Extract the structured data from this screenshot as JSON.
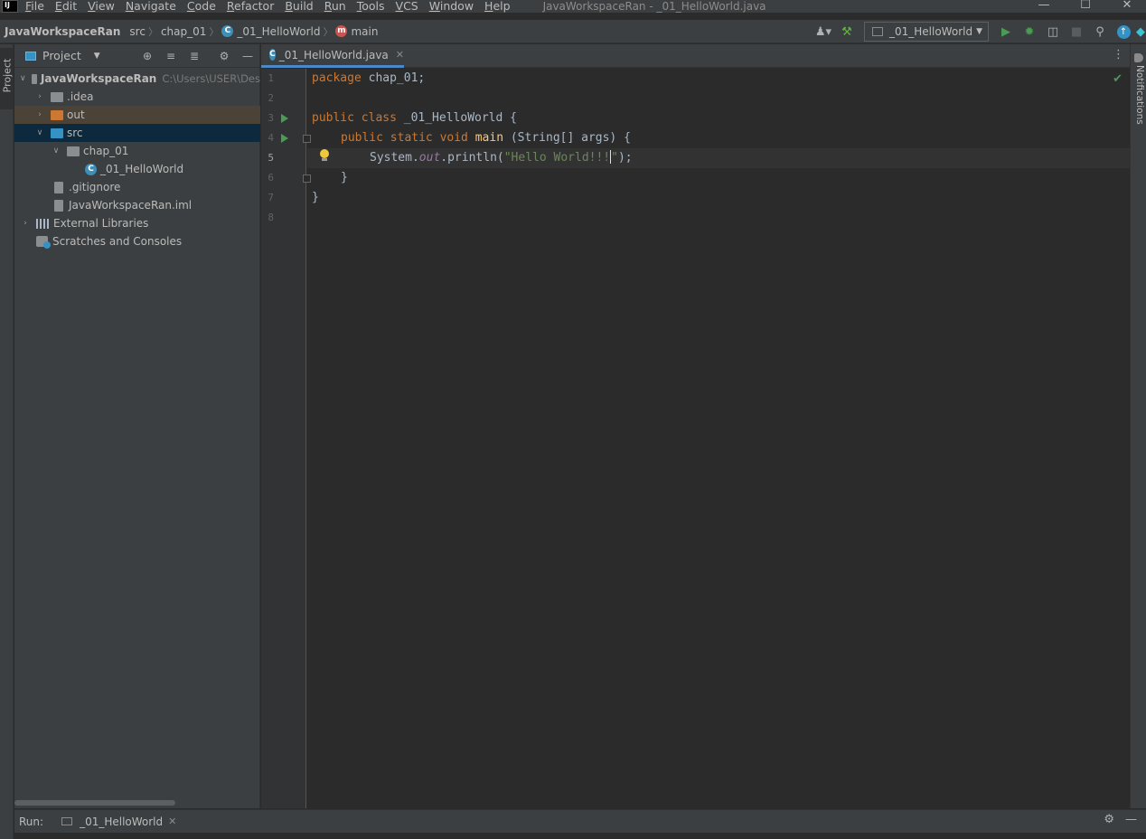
{
  "app": {
    "logo": "IJ",
    "window_title": "JavaWorkspaceRan - _01_HelloWorld.java",
    "menu": [
      "File",
      "Edit",
      "View",
      "Navigate",
      "Code",
      "Refactor",
      "Build",
      "Run",
      "Tools",
      "VCS",
      "Window",
      "Help"
    ],
    "window_controls": {
      "minimize": "—",
      "maximize": "☐",
      "close": "✕"
    }
  },
  "navbar": {
    "crumbs": [
      "JavaWorkspaceRan",
      "src",
      "chap_01",
      "_01_HelloWorld",
      "main"
    ],
    "class_icon": "C",
    "method_icon": "m",
    "run_config": "_01_HelloWorld"
  },
  "left_strip": {
    "project_tab": "Project"
  },
  "right_strip": {
    "notifications_tab": "Notifications"
  },
  "project_panel": {
    "title": "Project",
    "tree": {
      "root": {
        "label": "JavaWorkspaceRan",
        "path": "C:\\Users\\USER\\Des"
      },
      "idea": ".idea",
      "out": "out",
      "src": "src",
      "chap": "chap_01",
      "hello": "_01_HelloWorld",
      "gitignore": ".gitignore",
      "iml": "JavaWorkspaceRan.iml",
      "ext_libs": "External Libraries",
      "scratches": "Scratches and Consoles"
    }
  },
  "editor": {
    "tab_label": "_01_HelloWorld.java",
    "line_numbers": [
      "1",
      "2",
      "3",
      "4",
      "5",
      "6",
      "7",
      "8"
    ],
    "code": {
      "l1_kw": "package",
      "l1_rest": " chap_01;",
      "l3_kw": "public class",
      "l3_rest": " _01_HelloWorld {",
      "l4_kw": "public static void",
      "l4_fn": "main",
      "l4_rest": " (String[] args) {",
      "l5_a": "System.",
      "l5_fld": "out",
      "l5_b": ".println(",
      "l5_str1": "\"Hello World!!!",
      "l5_str2": "\"",
      "l5_end": ");",
      "l6": "}",
      "l7": "}"
    }
  },
  "runbar": {
    "label": "Run:",
    "tab": "_01_HelloWorld"
  }
}
